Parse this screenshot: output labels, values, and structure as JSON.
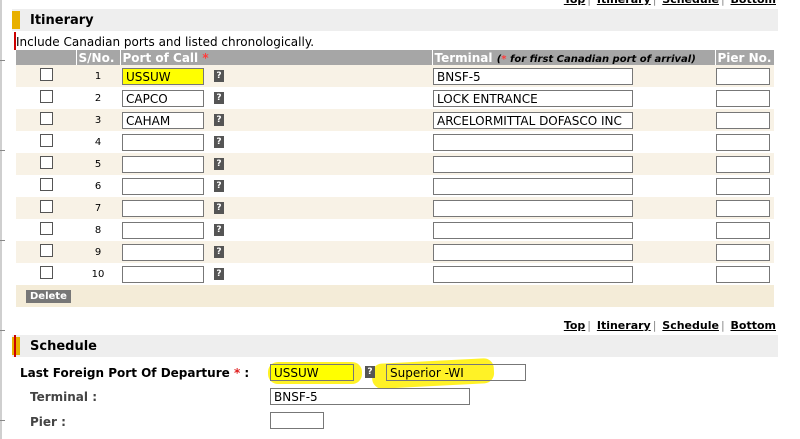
{
  "nav_links": [
    "Top",
    "Itinerary",
    "Schedule",
    "Bottom"
  ],
  "itinerary": {
    "title": "Itinerary",
    "note": "Include Canadian ports and listed chronologically.",
    "headers": {
      "sno": "S/No.",
      "port": "Port of Call",
      "terminal": "Terminal",
      "terminal_note": "for first Canadian port of arrival",
      "pier": "Pier No."
    },
    "required_mark": "*",
    "help_glyph": "?",
    "rows": [
      {
        "sno": "1",
        "port": "USSUW",
        "terminal": "BNSF-5",
        "pier": ""
      },
      {
        "sno": "2",
        "port": "CAPCO",
        "terminal": "LOCK ENTRANCE",
        "pier": ""
      },
      {
        "sno": "3",
        "port": "CAHAM",
        "terminal": "ARCELORMITTAL DOFASCO INC",
        "pier": ""
      },
      {
        "sno": "4",
        "port": "",
        "terminal": "",
        "pier": ""
      },
      {
        "sno": "5",
        "port": "",
        "terminal": "",
        "pier": ""
      },
      {
        "sno": "6",
        "port": "",
        "terminal": "",
        "pier": ""
      },
      {
        "sno": "7",
        "port": "",
        "terminal": "",
        "pier": ""
      },
      {
        "sno": "8",
        "port": "",
        "terminal": "",
        "pier": ""
      },
      {
        "sno": "9",
        "port": "",
        "terminal": "",
        "pier": ""
      },
      {
        "sno": "10",
        "port": "",
        "terminal": "",
        "pier": ""
      }
    ],
    "delete_label": "Delete"
  },
  "schedule": {
    "title": "Schedule",
    "last_port_label": "Last Foreign Port Of Departure",
    "last_port_code": "USSUW",
    "last_port_name": "Superior -WI",
    "terminal_label": "Terminal :",
    "terminal_value": "BNSF-5",
    "pier_label": "Pier :",
    "pier_value": ""
  },
  "colors": {
    "accent": "#e8b000",
    "highlight": "#ffff00",
    "header_gray": "#a6a6a6",
    "required": "#ff3b3b"
  }
}
